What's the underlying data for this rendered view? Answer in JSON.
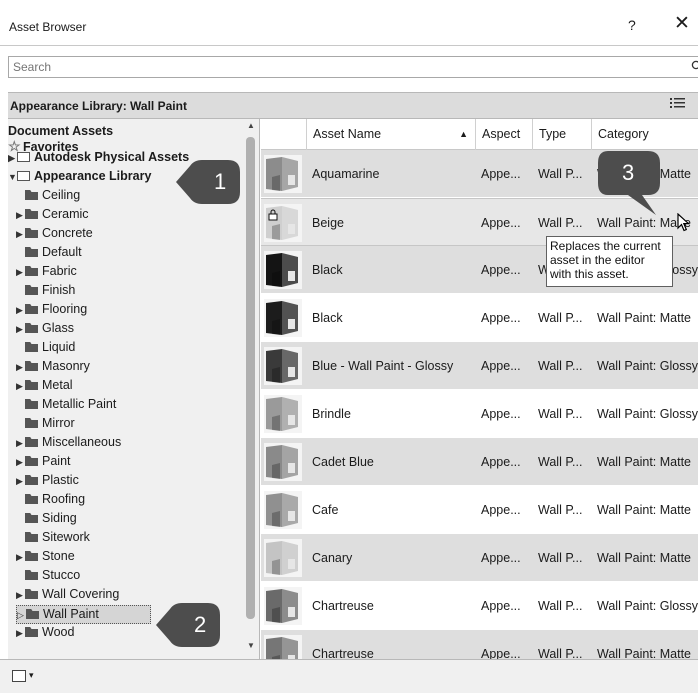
{
  "window": {
    "title": "Asset Browser",
    "help": "?",
    "close": "✕"
  },
  "search": {
    "placeholder": "Search",
    "icon": "search-icon"
  },
  "library_header": {
    "title": "Appearance Library: Wall Paint",
    "view_icon": "list-view-icon"
  },
  "tree": [
    {
      "label": "Document Assets",
      "bold": true,
      "icon": "none",
      "arrow": "",
      "indent": 0
    },
    {
      "label": "Favorites",
      "bold": true,
      "icon": "star",
      "arrow": "",
      "indent": 0
    },
    {
      "label": "Autodesk Physical Assets",
      "bold": true,
      "icon": "folder-outline",
      "arrow": "▶",
      "indent": 0
    },
    {
      "label": "Appearance Library",
      "bold": true,
      "icon": "folder-outline",
      "arrow": "▼",
      "indent": 0
    },
    {
      "label": "Ceiling",
      "bold": false,
      "icon": "folder",
      "arrow": "",
      "indent": 1
    },
    {
      "label": "Ceramic",
      "bold": false,
      "icon": "folder",
      "arrow": "▶",
      "indent": 1
    },
    {
      "label": "Concrete",
      "bold": false,
      "icon": "folder",
      "arrow": "▶",
      "indent": 1
    },
    {
      "label": "Default",
      "bold": false,
      "icon": "folder",
      "arrow": "",
      "indent": 1
    },
    {
      "label": "Fabric",
      "bold": false,
      "icon": "folder",
      "arrow": "▶",
      "indent": 1
    },
    {
      "label": "Finish",
      "bold": false,
      "icon": "folder",
      "arrow": "",
      "indent": 1
    },
    {
      "label": "Flooring",
      "bold": false,
      "icon": "folder",
      "arrow": "▶",
      "indent": 1
    },
    {
      "label": "Glass",
      "bold": false,
      "icon": "folder",
      "arrow": "▶",
      "indent": 1
    },
    {
      "label": "Liquid",
      "bold": false,
      "icon": "folder",
      "arrow": "",
      "indent": 1
    },
    {
      "label": "Masonry",
      "bold": false,
      "icon": "folder",
      "arrow": "▶",
      "indent": 1
    },
    {
      "label": "Metal",
      "bold": false,
      "icon": "folder",
      "arrow": "▶",
      "indent": 1
    },
    {
      "label": "Metallic Paint",
      "bold": false,
      "icon": "folder",
      "arrow": "",
      "indent": 1
    },
    {
      "label": "Mirror",
      "bold": false,
      "icon": "folder",
      "arrow": "",
      "indent": 1
    },
    {
      "label": "Miscellaneous",
      "bold": false,
      "icon": "folder",
      "arrow": "▶",
      "indent": 1
    },
    {
      "label": "Paint",
      "bold": false,
      "icon": "folder",
      "arrow": "▶",
      "indent": 1
    },
    {
      "label": "Plastic",
      "bold": false,
      "icon": "folder",
      "arrow": "▶",
      "indent": 1
    },
    {
      "label": "Roofing",
      "bold": false,
      "icon": "folder",
      "arrow": "",
      "indent": 1
    },
    {
      "label": "Siding",
      "bold": false,
      "icon": "folder",
      "arrow": "",
      "indent": 1
    },
    {
      "label": "Sitework",
      "bold": false,
      "icon": "folder",
      "arrow": "",
      "indent": 1
    },
    {
      "label": "Stone",
      "bold": false,
      "icon": "folder",
      "arrow": "▶",
      "indent": 1
    },
    {
      "label": "Stucco",
      "bold": false,
      "icon": "folder",
      "arrow": "",
      "indent": 1
    },
    {
      "label": "Wall Covering",
      "bold": false,
      "icon": "folder",
      "arrow": "▶",
      "indent": 1
    },
    {
      "label": "Wall Paint",
      "bold": false,
      "icon": "folder",
      "arrow": "▷",
      "indent": 1,
      "selected": true
    },
    {
      "label": "Wood",
      "bold": false,
      "icon": "folder",
      "arrow": "▶",
      "indent": 1
    }
  ],
  "columns": [
    {
      "label": "",
      "sortable": false
    },
    {
      "label": "Asset Name",
      "sortable": true,
      "sort": "▲"
    },
    {
      "label": "Aspect",
      "sortable": false
    },
    {
      "label": "Type",
      "sortable": false
    },
    {
      "label": "Category",
      "sortable": false
    }
  ],
  "rows": [
    {
      "name": "Aquamarine",
      "aspect": "Appe...",
      "type": "Wall P...",
      "category": "Wall Paint: Matte",
      "swatch": "#8c8c8c",
      "locked": false
    },
    {
      "name": "Beige",
      "aspect": "Appe...",
      "type": "Wall P...",
      "category": "Wall Paint: Matte",
      "swatch": "#cfcfcf",
      "locked": true,
      "selected": true
    },
    {
      "name": "Black",
      "aspect": "Appe...",
      "type": "Wall P...",
      "category": "Wall Paint: Glossy",
      "swatch": "#141414",
      "locked": false
    },
    {
      "name": "Black",
      "aspect": "Appe...",
      "type": "Wall P...",
      "category": "Wall Paint: Matte",
      "swatch": "#1c1c1c",
      "locked": false
    },
    {
      "name": "Blue - Wall Paint - Glossy",
      "aspect": "Appe...",
      "type": "Wall P...",
      "category": "Wall Paint: Glossy",
      "swatch": "#3a3a3a",
      "locked": false
    },
    {
      "name": "Brindle",
      "aspect": "Appe...",
      "type": "Wall P...",
      "category": "Wall Paint: Glossy",
      "swatch": "#9a9a9a",
      "locked": false
    },
    {
      "name": "Cadet Blue",
      "aspect": "Appe...",
      "type": "Wall P...",
      "category": "Wall Paint: Matte",
      "swatch": "#8a8a8a",
      "locked": false
    },
    {
      "name": "Cafe",
      "aspect": "Appe...",
      "type": "Wall P...",
      "category": "Wall Paint: Matte",
      "swatch": "#909090",
      "locked": false
    },
    {
      "name": "Canary",
      "aspect": "Appe...",
      "type": "Wall P...",
      "category": "Wall Paint: Matte",
      "swatch": "#c4c4c4",
      "locked": false
    },
    {
      "name": "Chartreuse",
      "aspect": "Appe...",
      "type": "Wall P...",
      "category": "Wall Paint: Glossy",
      "swatch": "#6a6a6a",
      "locked": false
    },
    {
      "name": "Chartreuse",
      "aspect": "Appe...",
      "type": "Wall P...",
      "category": "Wall Paint: Matte",
      "swatch": "#767676",
      "locked": false
    }
  ],
  "tooltip": {
    "text": "Replaces the current asset in the editor with this asset."
  },
  "callouts": [
    {
      "label": "1",
      "color": "#4d4d4d"
    },
    {
      "label": "2",
      "color": "#4d4d4d"
    },
    {
      "label": "3",
      "color": "#4d4d4d"
    }
  ],
  "bottombar": {
    "icon": "library-icon",
    "dropdown": "▾"
  }
}
